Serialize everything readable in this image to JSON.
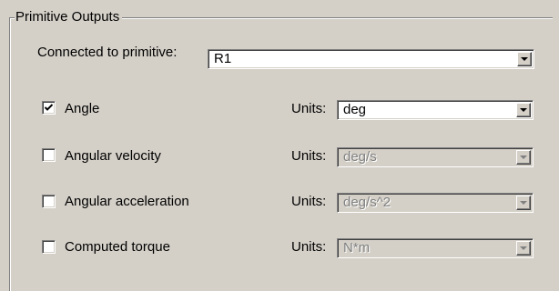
{
  "group": {
    "title": "Primitive Outputs"
  },
  "connected": {
    "label": "Connected to primitive:",
    "value": "R1"
  },
  "units_label": "Units:",
  "outputs": [
    {
      "label": "Angle",
      "checked": true,
      "unit": "deg",
      "enabled": true
    },
    {
      "label": "Angular velocity",
      "checked": false,
      "unit": "deg/s",
      "enabled": false
    },
    {
      "label": "Angular acceleration",
      "checked": false,
      "unit": "deg/s^2",
      "enabled": false
    },
    {
      "label": "Computed torque",
      "checked": false,
      "unit": "N*m",
      "enabled": false
    }
  ]
}
